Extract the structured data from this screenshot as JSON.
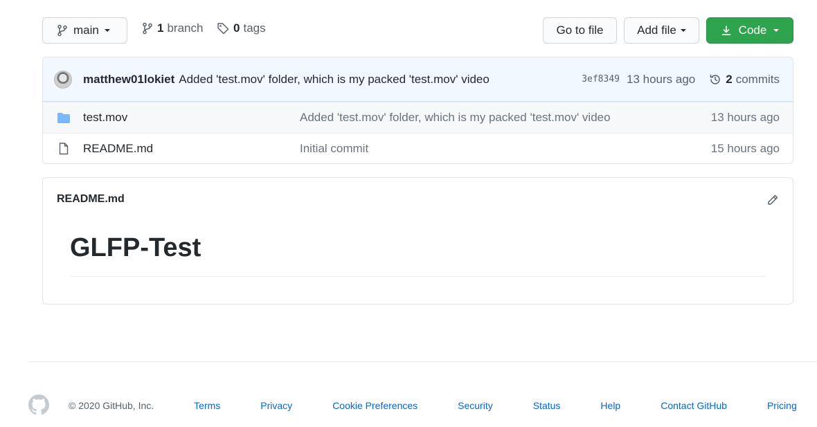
{
  "toolbar": {
    "branch_label": "main",
    "branch_count": "1",
    "branch_word": "branch",
    "tag_count": "0",
    "tag_word": "tags",
    "goto_label": "Go to file",
    "addfile_label": "Add file",
    "code_label": "Code",
    "code_color": "#2ea44f"
  },
  "commit": {
    "author": "matthew01lokiet",
    "message": "Added 'test.mov' folder, which is my packed 'test.mov' video",
    "sha": "3ef8349",
    "time": "13 hours ago",
    "commit_count": "2",
    "commit_word": "commits"
  },
  "files": [
    {
      "icon": "folder-icon",
      "name": "test.mov",
      "message": "Added 'test.mov' folder, which is my packed 'test.mov' video",
      "age": "13 hours ago"
    },
    {
      "icon": "file-icon",
      "name": "README.md",
      "message": "Initial commit",
      "age": "15 hours ago"
    }
  ],
  "readme": {
    "title": "README.md",
    "heading": "GLFP-Test"
  },
  "footer": {
    "copyright": "© 2020 GitHub, Inc.",
    "links": [
      "Terms",
      "Privacy",
      "Cookie Preferences",
      "Security",
      "Status",
      "Help",
      "Contact GitHub",
      "Pricing"
    ]
  }
}
